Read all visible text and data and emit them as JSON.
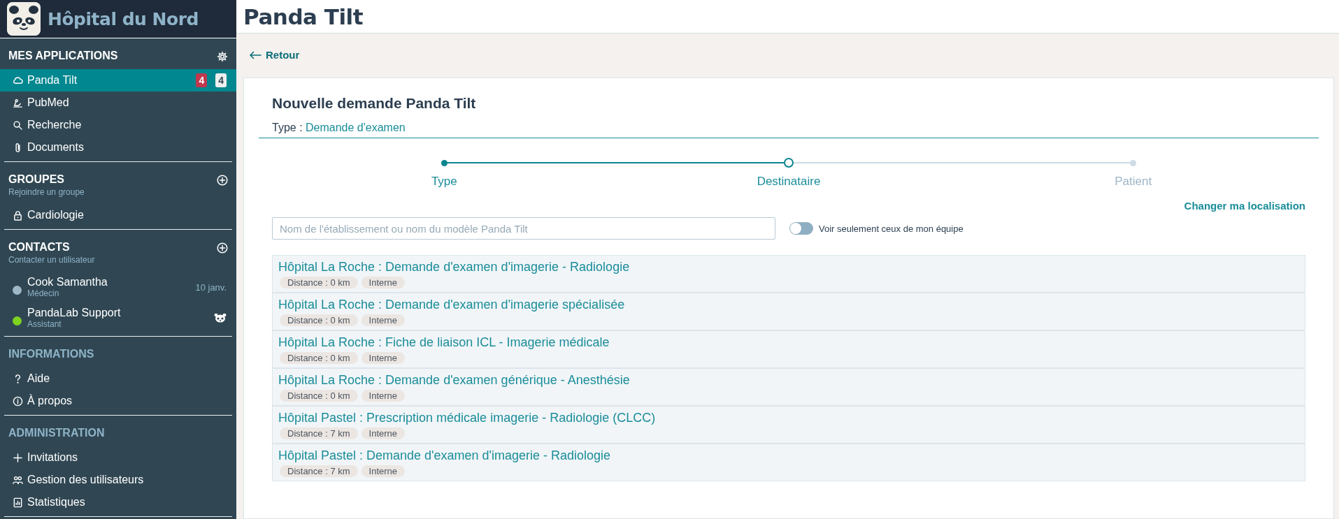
{
  "sidebar": {
    "brand": "Hôpital du Nord",
    "sections": [
      {
        "title": "MES APPLICATIONS",
        "dimmed": false,
        "items": [
          {
            "label": "Panda Tilt",
            "selected": true,
            "badges": [
              {
                "text": "4",
                "kind": "alert"
              },
              {
                "text": "4",
                "kind": "plain"
              }
            ]
          },
          {
            "label": "PubMed",
            "selected": false
          },
          {
            "label": "Recherche",
            "selected": false
          },
          {
            "label": "Documents",
            "selected": false
          }
        ]
      },
      {
        "title": "GROUPES",
        "subtitle": "Rejoindre un groupe",
        "dimmed": false,
        "items": [
          {
            "label": "Cardiologie",
            "selected": false
          }
        ]
      },
      {
        "title": "CONTACTS",
        "subtitle": "Contacter un utilisateur",
        "dimmed": false,
        "contacts": [
          {
            "name": "Cook Samantha",
            "role": "Médecin",
            "color": "#9fb8c8",
            "kind": "person",
            "meta": "10 janv."
          },
          {
            "name": "PandaLab Support",
            "role": "Assistant",
            "color": "#7ed321",
            "kind": "bot"
          }
        ]
      },
      {
        "title": "INFORMATIONS",
        "dimmed": true,
        "items": [
          {
            "label": "Aide",
            "selected": false
          },
          {
            "label": "À propos",
            "selected": false
          }
        ]
      },
      {
        "title": "ADMINISTRATION",
        "dimmed": true,
        "items": [
          {
            "label": "Invitations",
            "selected": false
          },
          {
            "label": "Gestion des utilisateurs",
            "selected": false
          },
          {
            "label": "Statistiques",
            "selected": false
          }
        ]
      }
    ]
  },
  "page": {
    "title": "Panda Tilt",
    "back": "Retour"
  },
  "card": {
    "title": "Nouvelle demande Panda Tilt",
    "type_label": "Type :",
    "type_value": "Demande d'examen",
    "steps": [
      {
        "label": "Type",
        "done": true,
        "selected": false
      },
      {
        "label": "Destinataire",
        "done": false,
        "selected": true
      },
      {
        "label": "Patient",
        "done": false,
        "selected": false
      }
    ],
    "location_link": "Changer ma localisation",
    "search": {
      "placeholder": "Nom de l'établissement ou nom du modèle Panda Tilt"
    },
    "team_toggle": {
      "label": "Voir seulement ceux de mon équipe",
      "on": false
    },
    "results": [
      {
        "title": "Hôpital La Roche : Demande d'examen d'imagerie - Radiologie",
        "tags": [
          "Distance : 0 km",
          "Interne"
        ]
      },
      {
        "title": "Hôpital La Roche : Demande d'examen d'imagerie spécialisée",
        "tags": [
          "Distance : 0 km",
          "Interne"
        ]
      },
      {
        "title": "Hôpital La Roche : Fiche de liaison ICL - Imagerie médicale",
        "tags": [
          "Distance : 0 km",
          "Interne"
        ]
      },
      {
        "title": "Hôpital La Roche : Demande d'examen générique - Anesthésie",
        "tags": [
          "Distance : 0 km",
          "Interne"
        ]
      },
      {
        "title": "Hôpital Pastel : Prescription médicale imagerie - Radiologie (CLCC)",
        "tags": [
          "Distance : 7 km",
          "Interne"
        ]
      },
      {
        "title": "Hôpital Pastel : Demande d'examen d'imagerie - Radiologie",
        "tags": [
          "Distance : 7 km",
          "Interne"
        ]
      }
    ]
  }
}
